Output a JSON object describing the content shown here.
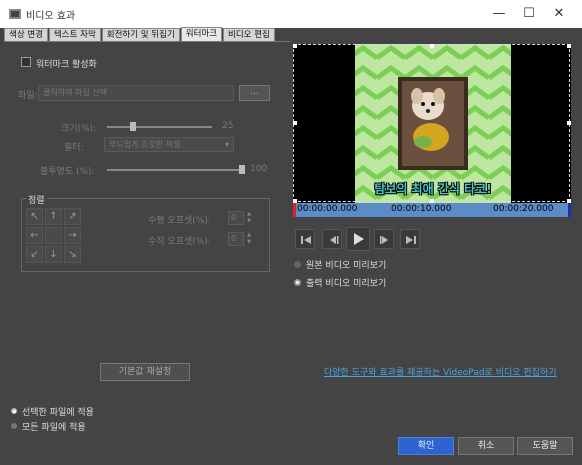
{
  "window": {
    "title": "비디오 효과",
    "minimize_glyph": "—",
    "maximize_glyph": "☐",
    "close_glyph": "✕"
  },
  "tabs": [
    {
      "label": "색상 변경"
    },
    {
      "label": "텍스트 자막"
    },
    {
      "label": "회전하기 및 뒤집기"
    },
    {
      "label": "워터마크",
      "active": true
    },
    {
      "label": "비디오 편집"
    }
  ],
  "watermark": {
    "enable_label": "워터마크 활성화",
    "file_label": "파일:",
    "file_placeholder": "클릭하여 파일 선택",
    "browse_label": "...",
    "size_label": "크기(%):",
    "size_value": "25",
    "size_fraction": 0.25,
    "filter_label": "필터:",
    "filter_value": "부드럽게 흐릿한 픽셀",
    "opacity_label": "불투명도 (%):",
    "opacity_value": "100",
    "opacity_fraction": 1.0
  },
  "alignment": {
    "group_label": "정렬",
    "arrows": [
      "↖",
      "↑",
      "↗",
      "←",
      "",
      "→",
      "↙",
      "↓",
      "↘"
    ],
    "h_offset_label": "수평 오프셋(%):",
    "h_offset_value": "0",
    "v_offset_label": "수직 오프셋(%):",
    "v_offset_value": "0"
  },
  "reset_label": "기본값 재설정",
  "apply_scope": {
    "selected_label": "선택한 파일에 적용",
    "all_label": "모든 파일에 적용"
  },
  "preview": {
    "caption": "탐보의 최애 간식 타코!",
    "time_start": "00:00:00.000",
    "time_mid": "00:00:10.000",
    "time_end": "00:00:20.000",
    "original_label": "원본 비디오 미리보기",
    "output_label": "출력 비디오 미리보기",
    "accent_color": "#2e63d1",
    "timeline_color": "#5b8cc8",
    "caption_color": "#4fc3c8"
  },
  "videopad_link": "다양한 도구와 효과를 제공하는 VideoPad로 비디오 편집하기",
  "buttons": {
    "ok": "확인",
    "cancel": "취소",
    "help": "도움말"
  }
}
